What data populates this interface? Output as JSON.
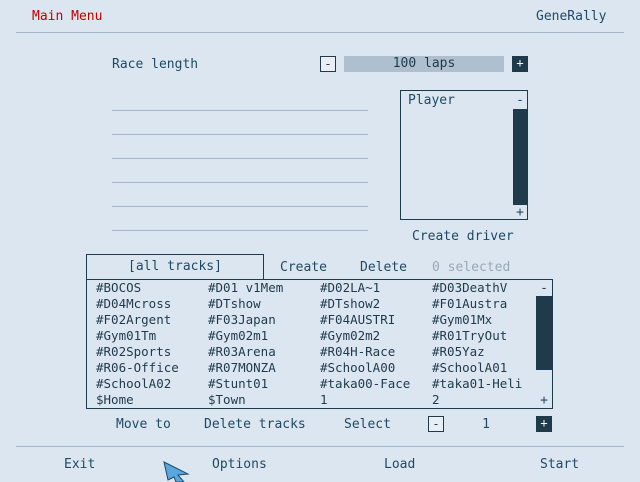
{
  "header": {
    "title": "Main Menu",
    "app_name": "GeneRally"
  },
  "race": {
    "label": "Race length",
    "value": "100 laps",
    "minus": "-",
    "plus": "+"
  },
  "player_panel": {
    "title": "Player",
    "minus": "-",
    "plus": "+"
  },
  "create_driver": "Create driver",
  "tracks": {
    "tab_all": "[all tracks]",
    "create": "Create",
    "delete": "Delete",
    "selected": "0 selected",
    "items": [
      "#BOCOS",
      "#D01 v1Mem",
      "#D02LA~1",
      "#D03DeathV",
      "#D04Mcross",
      "#DTshow",
      "#DTshow2",
      "#F01Austra",
      "#F02Argent",
      "#F03Japan",
      "#F04AUSTRI",
      "#Gym01Mx",
      "#Gym01Tm",
      "#Gym02m1",
      "#Gym02m2",
      "#R01TryOut",
      "#R02Sports",
      "#R03Arena",
      "#R04H-Race",
      "#R05Yaz",
      "#R06-Office",
      "#R07MONZA",
      "#SchoolA00",
      "#SchoolA01",
      "#SchoolA02",
      "#Stunt01",
      "#taka00-Face",
      "#taka01-Heli",
      "$Home",
      "$Town",
      "1",
      "2"
    ],
    "scroll_minus": "-",
    "scroll_plus": "+"
  },
  "track_actions": {
    "move_to": "Move to",
    "delete_tracks": "Delete tracks",
    "select": "Select",
    "minus": "-",
    "value": "1",
    "plus": "+"
  },
  "footer": {
    "exit": "Exit",
    "options": "Options",
    "load": "Load",
    "start": "Start"
  },
  "colors": {
    "background": "#dce6f0",
    "text": "#1f4a63",
    "title_red": "#c00000",
    "dark": "#1f3a4b",
    "muted": "#9aa8b5",
    "bar": "#aebfcf"
  }
}
